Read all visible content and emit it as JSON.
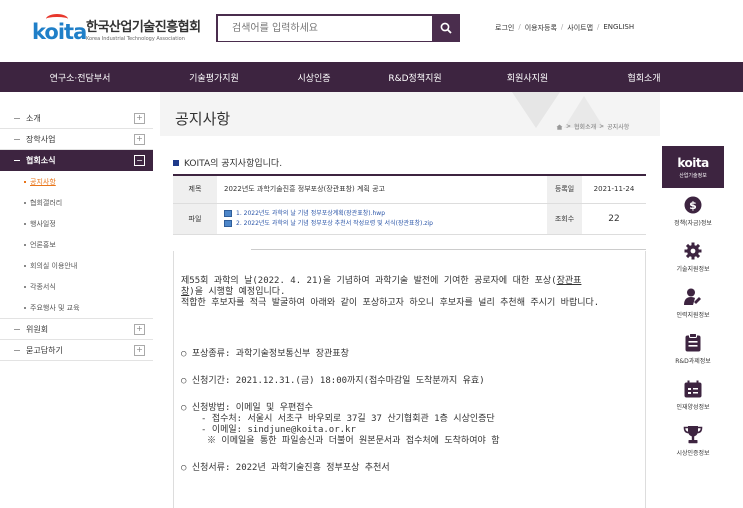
{
  "header": {
    "logo_text": "koita",
    "org_name_ko": "한국산업기술진흥협회",
    "org_name_en": "Korea Industrial Technology Association",
    "search_placeholder": "검색어를 입력하세요",
    "top_links": [
      "로그인",
      "이용자등록",
      "사이트맵",
      "ENGLISH"
    ]
  },
  "gnb": [
    "연구소·전담부서",
    "기술평가지원",
    "시상인증",
    "R&D정책지원",
    "회원사지원",
    "협회소개"
  ],
  "sidebar": {
    "items": [
      {
        "label": "소개",
        "toggle": "+"
      },
      {
        "label": "장학사업",
        "toggle": "+"
      },
      {
        "label": "협회소식",
        "toggle": "−"
      }
    ],
    "subitems": [
      "공지사항",
      "협회갤러리",
      "행사일정",
      "언론홍보",
      "회의실 이용안내",
      "각종서식",
      "주요행사 및 교육"
    ],
    "items_after": [
      {
        "label": "위원회",
        "toggle": "+"
      },
      {
        "label": "묻고답하기",
        "toggle": "+"
      }
    ]
  },
  "page": {
    "title": "공지사항",
    "breadcrumb": [
      "협회소개",
      "공지사항"
    ],
    "section_title": "KOITA의 공지사항입니다."
  },
  "notice": {
    "subject_label": "제목",
    "subject": "2022년도 과학기술진흥 정부포상(장관표창) 계획 공고",
    "date_label": "등록일",
    "date": "2021-11-24",
    "file_label": "파일",
    "files": [
      "1. 2022년도 과학의 날 기념 정부포상계획(장관표창).hwp",
      "2. 2022년도 과학의 날 기념 정부포상 추천서 작성요령 및 서식(장관표창).zip"
    ],
    "views_label": "조회수",
    "views": "22"
  },
  "body": {
    "para1_a": "제55회 과학의 날(2022. 4. 21)을 기념하여 과학기술 발전에 기여한 공로자에 대한 포상(",
    "para1_u1": "장관표",
    "para1_u2": "창",
    "para1_b": ")을 시행할 예정입니다.",
    "para2": "적합한 후보자를 적극 발굴하여 아래와 같이 포상하고자 하오니 후보자를 널리 추천해 주시기 바랍니다.",
    "item1": "○ 포상종류: 과학기술정보통신부 장관표창",
    "item2": "○ 신청기간: 2021.12.31.(금) 18:00까지(접수마감일 도착분까지 유효)",
    "item3": "○ 신청방법: 이메일 및 우편접수",
    "item3_a": "- 접수처: 서울시 서초구 바우뫼로 37길 37 산기협회관 1층 시상인증단",
    "item3_b": "- 이메일: sindjune@koita.or.kr",
    "item3_c": "※ 이메일을 통한 파일송신과 더불어 원본문서과 접수처에 도착하여야 함",
    "item4": "○ 신청서류: 2022년 과학기술진흥 정부포상 추천서"
  },
  "quick_menu": {
    "top_logo": "koita",
    "top_label": "산업기술정보",
    "items": [
      {
        "label": "정책(자금)정보",
        "icon": "dollar-icon"
      },
      {
        "label": "기술지원정보",
        "icon": "gear-icon"
      },
      {
        "label": "인력지원정보",
        "icon": "person-icon"
      },
      {
        "label": "R&D과제정보",
        "icon": "clipboard-icon"
      },
      {
        "label": "인재양성정보",
        "icon": "calendar-icon"
      },
      {
        "label": "시상인증정보",
        "icon": "trophy-icon"
      }
    ]
  },
  "colors": {
    "brand_purple": "#3d2440",
    "accent_orange": "#e8751a",
    "logo_blue": "#1f7fc8",
    "link_blue": "#2a55a8"
  }
}
